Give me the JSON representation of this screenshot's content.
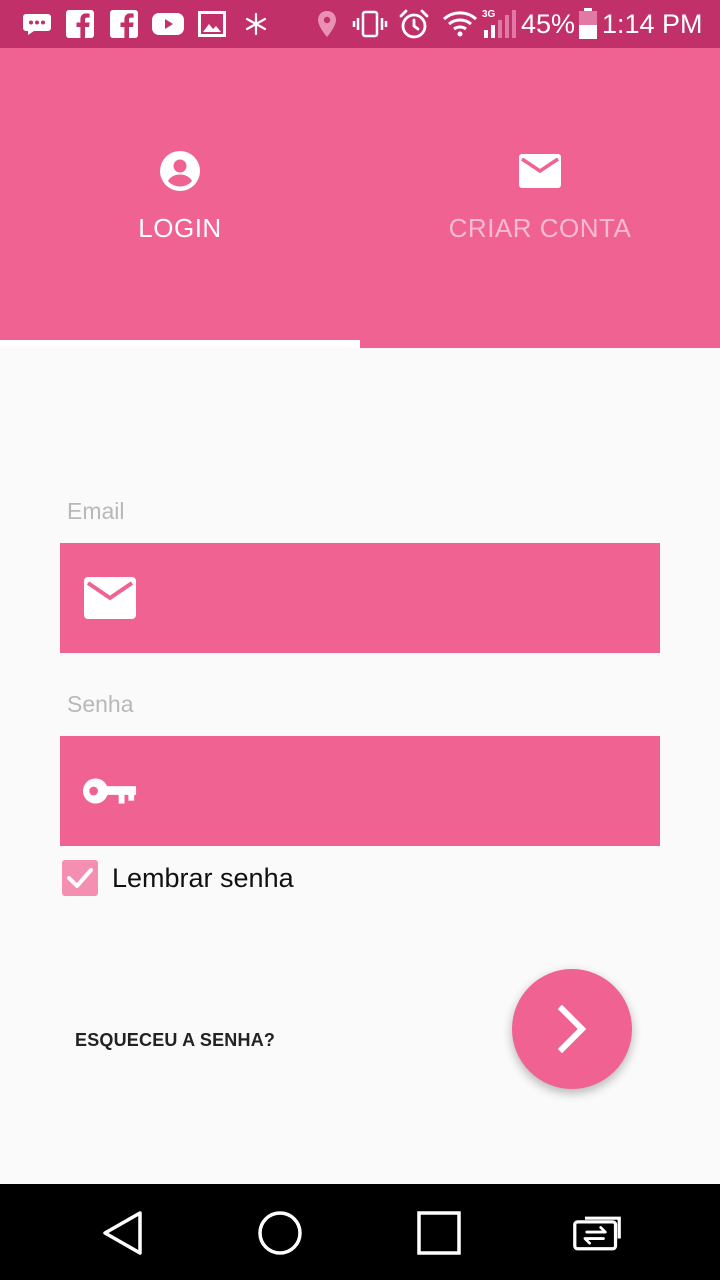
{
  "status_bar": {
    "battery": "45%",
    "time": "1:14 PM",
    "network": "3G",
    "icons": [
      "message-icon",
      "facebook-icon",
      "facebook-icon",
      "youtube-icon",
      "gallery-icon",
      "asterisk-icon",
      "location-icon",
      "vibrate-icon",
      "alarm-icon",
      "wifi-icon",
      "signal-icon",
      "battery-icon"
    ]
  },
  "tabs": [
    {
      "label": "LOGIN",
      "icon": "account-circle-icon",
      "selected": true
    },
    {
      "label": "CRIAR CONTA",
      "icon": "mail-icon",
      "selected": false
    }
  ],
  "form": {
    "email_label": "Email",
    "email_value": "",
    "password_label": "Senha",
    "password_value": "",
    "remember_label": "Lembrar senha",
    "remember_checked": true,
    "forgot_label": "ESQUECEU A SENHA?"
  },
  "colors": {
    "accent": "#f06292",
    "status_bar": "#c2306a",
    "checkbox": "#f48fb1",
    "inactive_tab_text": "#f8bbd0"
  },
  "nav_bar": [
    "back-icon",
    "home-icon",
    "recents-icon",
    "switch-apps-icon"
  ]
}
